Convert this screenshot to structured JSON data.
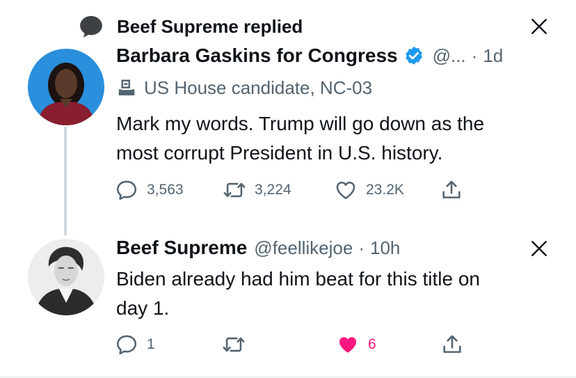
{
  "context": {
    "text": "Beef Supreme replied",
    "icon": "comment-bubble-icon"
  },
  "tweet1": {
    "name": "Barbara Gaskins for Congress",
    "verified": true,
    "handle": "@...",
    "separator": "·",
    "time": "1d",
    "label_icon": "ballot-box-icon",
    "label": "US House candidate, NC-03",
    "text_line1": "Mark my words. Trump will go down as the",
    "text_line2": "most corrupt President in U.S. history.",
    "replies": "3,563",
    "retweets": "3,224",
    "likes": "23.2K"
  },
  "tweet2": {
    "name": "Beef Supreme",
    "handle": "@feellikejoe",
    "separator": "·",
    "time": "10h",
    "text_line1": "Biden already had him beat for this title on",
    "text_line2": "day 1.",
    "replies": "1",
    "retweets": "",
    "likes": "6",
    "liked": true
  },
  "colors": {
    "text": "#0f1419",
    "secondary": "#536471",
    "verified_blue": "#1d9bf0",
    "like_pink": "#f91880",
    "thread_line": "#cfd9de"
  }
}
